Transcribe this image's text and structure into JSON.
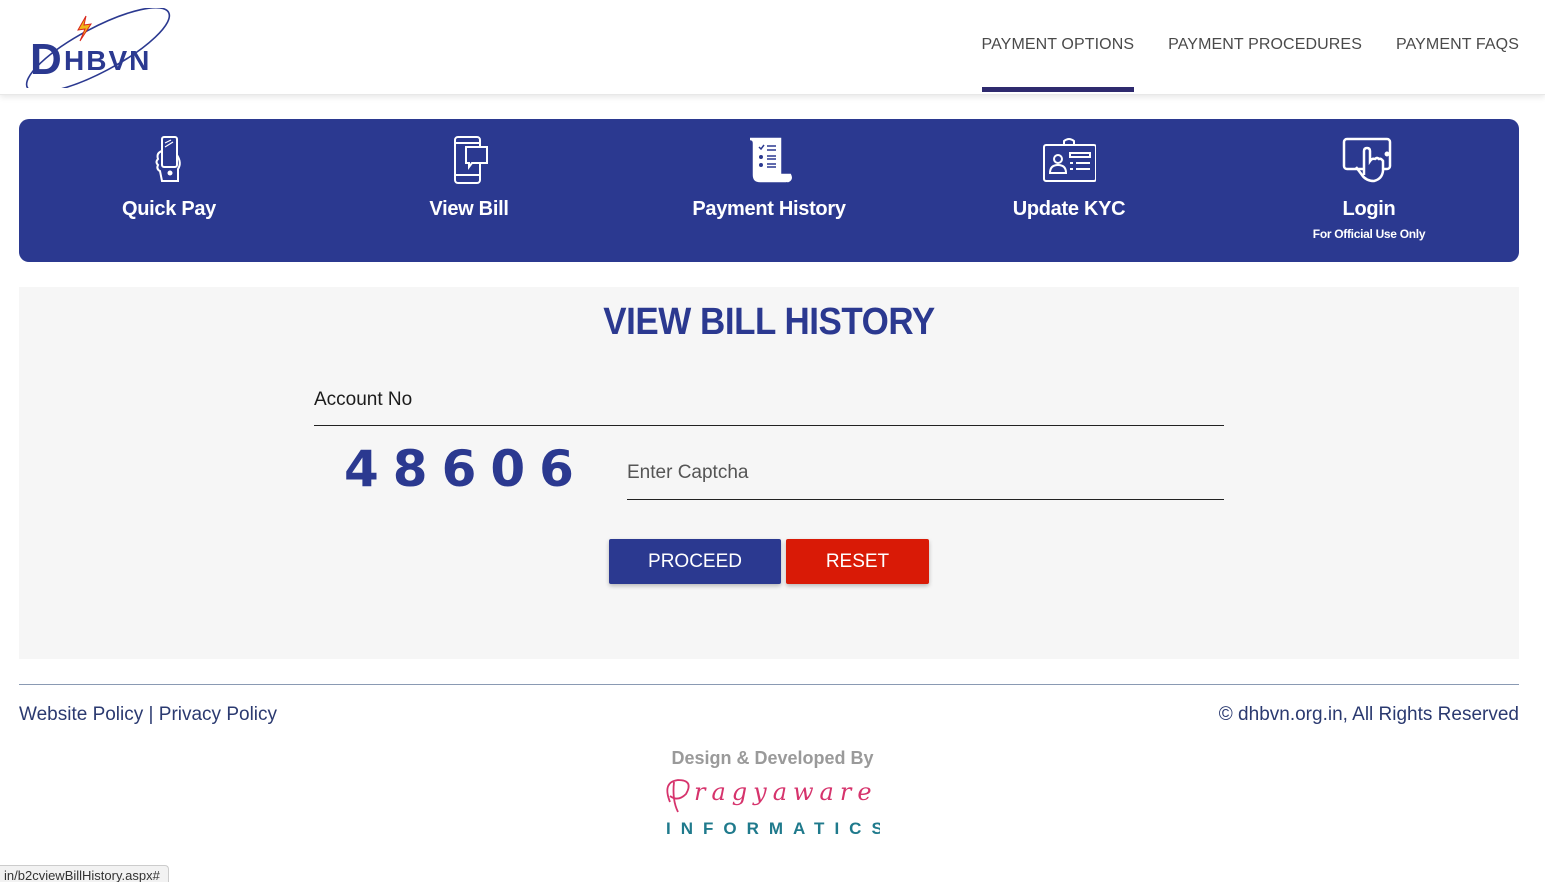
{
  "header": {
    "logo_text": "DHBVN",
    "nav": [
      {
        "label": "PAYMENT OPTIONS",
        "active": true
      },
      {
        "label": "PAYMENT PROCEDURES",
        "active": false
      },
      {
        "label": "PAYMENT FAQS",
        "active": false
      }
    ]
  },
  "services": [
    {
      "label": "Quick Pay",
      "icon": "hand-phone-icon"
    },
    {
      "label": "View Bill",
      "icon": "phone-message-icon"
    },
    {
      "label": "Payment History",
      "icon": "receipt-scroll-icon"
    },
    {
      "label": "Update KYC",
      "icon": "id-card-icon"
    },
    {
      "label": "Login",
      "sub": "For Official Use Only",
      "icon": "tablet-touch-icon"
    }
  ],
  "form": {
    "title": "VIEW BILL HISTORY",
    "account_placeholder": "Account No",
    "account_value": "",
    "captcha_code": "48606",
    "captcha_placeholder": "Enter Captcha",
    "captcha_value": "",
    "proceed_label": "PROCEED",
    "reset_label": "RESET"
  },
  "footer": {
    "website_policy": "Website Policy",
    "separator": " | ",
    "privacy_policy": "Privacy Policy",
    "copyright": "© dhbvn.org.in, All Rights Reserved",
    "credit": "Design & Developed By",
    "vendor_name": "Pragyaware",
    "vendor_sub": "INFORMATICS"
  },
  "status_url": "in/b2cviewBillHistory.aspx#",
  "colors": {
    "brand_blue": "#2b3990",
    "reset_red": "#d91a06",
    "nav_active_bar": "#2e2a6e",
    "vendor_pink": "#d6336c",
    "vendor_teal": "#1f7a8c"
  }
}
